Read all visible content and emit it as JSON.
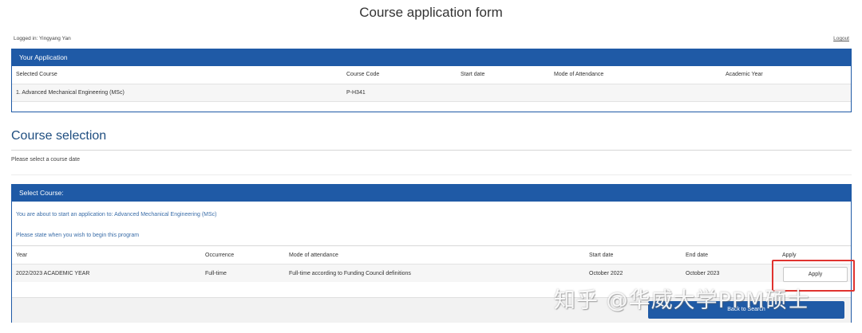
{
  "title": "Course application form",
  "session": {
    "logged_in": "Logged in: Yingyang Yan",
    "logout": "Logout"
  },
  "your_application": {
    "heading": "Your Application",
    "columns": [
      "Selected Course",
      "Course Code",
      "Start date",
      "Mode of Attendance",
      "Academic Year"
    ],
    "rows": [
      [
        "1. Advanced Mechanical Engineering (MSc)",
        "P-H341",
        "",
        "",
        ""
      ]
    ]
  },
  "course_selection": {
    "title": "Course selection",
    "subtitle": "Please select a course date"
  },
  "select_course": {
    "heading": "Select Course:",
    "intro": "You are about to start an application to: Advanced Mechanical Engineering (MSc)",
    "prompt": "Please state when you wish to begin this program",
    "columns": [
      "Year",
      "Occurrence",
      "Mode of attendance",
      "Start date",
      "End date",
      "Apply"
    ],
    "rows": [
      [
        "2022/2023 ACADEMIC YEAR",
        "Full-time",
        "Full-time according to Funding Council definitions",
        "October 2022",
        "October 2023"
      ]
    ],
    "apply_label": "Apply",
    "back_label": "Back to Search"
  },
  "annotation": {
    "highlight_color": "#e0332f"
  },
  "watermark": "知乎 @华威大学PPM硕士",
  "colors": {
    "primary": "#1f5aa6",
    "heading_text": "#1f4e80",
    "link_text": "#3a6da8"
  }
}
